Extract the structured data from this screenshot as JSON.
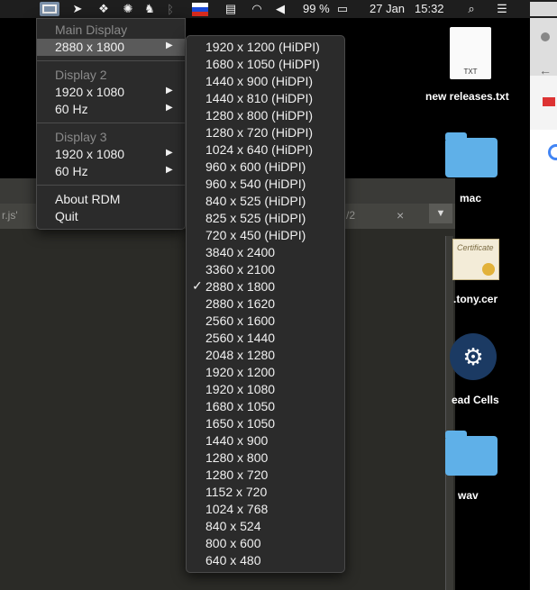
{
  "menubar": {
    "battery_percent": "99 %",
    "date": "27 Jan",
    "time": "15:32",
    "icons": [
      "rdm-icon",
      "location-icon",
      "dropbox-icon",
      "extension-icon",
      "evernote-icon",
      "bluetooth-icon",
      "flag-icon",
      "keyboard-icon",
      "wifi-icon",
      "volume-icon",
      "battery-icon",
      "search-icon",
      "control-center-icon"
    ]
  },
  "rdm_menu": {
    "main_display_header": "Main Display",
    "main_resolution": "2880 x 1800",
    "display2_header": "Display 2",
    "display2_resolution": "1920 x 1080",
    "display2_refresh": "60 Hz",
    "display3_header": "Display 3",
    "display3_resolution": "1920 x 1080",
    "display3_refresh": "60 Hz",
    "about": "About RDM",
    "quit": "Quit"
  },
  "resolutions": [
    "1920 x 1200 (HiDPI)",
    "1680 x 1050 (HiDPI)",
    "1440 x 900 (HiDPI)",
    "1440 x 810 (HiDPI)",
    "1280 x 800 (HiDPI)",
    "1280 x 720 (HiDPI)",
    "1024 x 640 (HiDPI)",
    "960 x 600 (HiDPI)",
    "960 x 540 (HiDPI)",
    "840 x 525 (HiDPI)",
    "825 x 525 (HiDPI)",
    "720 x 450 (HiDPI)",
    "3840 x 2400",
    "3360 x 2100",
    "2880 x 1800",
    "2880 x 1620",
    "2560 x 1600",
    "2560 x 1440",
    "2048 x 1280",
    "1920 x 1200",
    "1920 x 1080",
    "1680 x 1050",
    "1650 x 1050",
    "1440 x 900",
    "1280 x 800",
    "1280 x 720",
    "1152 x 720",
    "1024 x 768",
    "840 x 524",
    "800 x 600",
    "640 x 480"
  ],
  "checked_resolution_index": 14,
  "checkmark": "✓",
  "desktop": {
    "txt_badge": "TXT",
    "file1": "new releases.txt",
    "folder1": "mac",
    "cert_badge": "Certificate",
    "cert_file": ".tony.cer",
    "steam_app": "ead Cells",
    "folder2": "wav"
  },
  "editor": {
    "tab_left": "r.js'",
    "tab_right": "/2",
    "close_glyph": "×"
  }
}
